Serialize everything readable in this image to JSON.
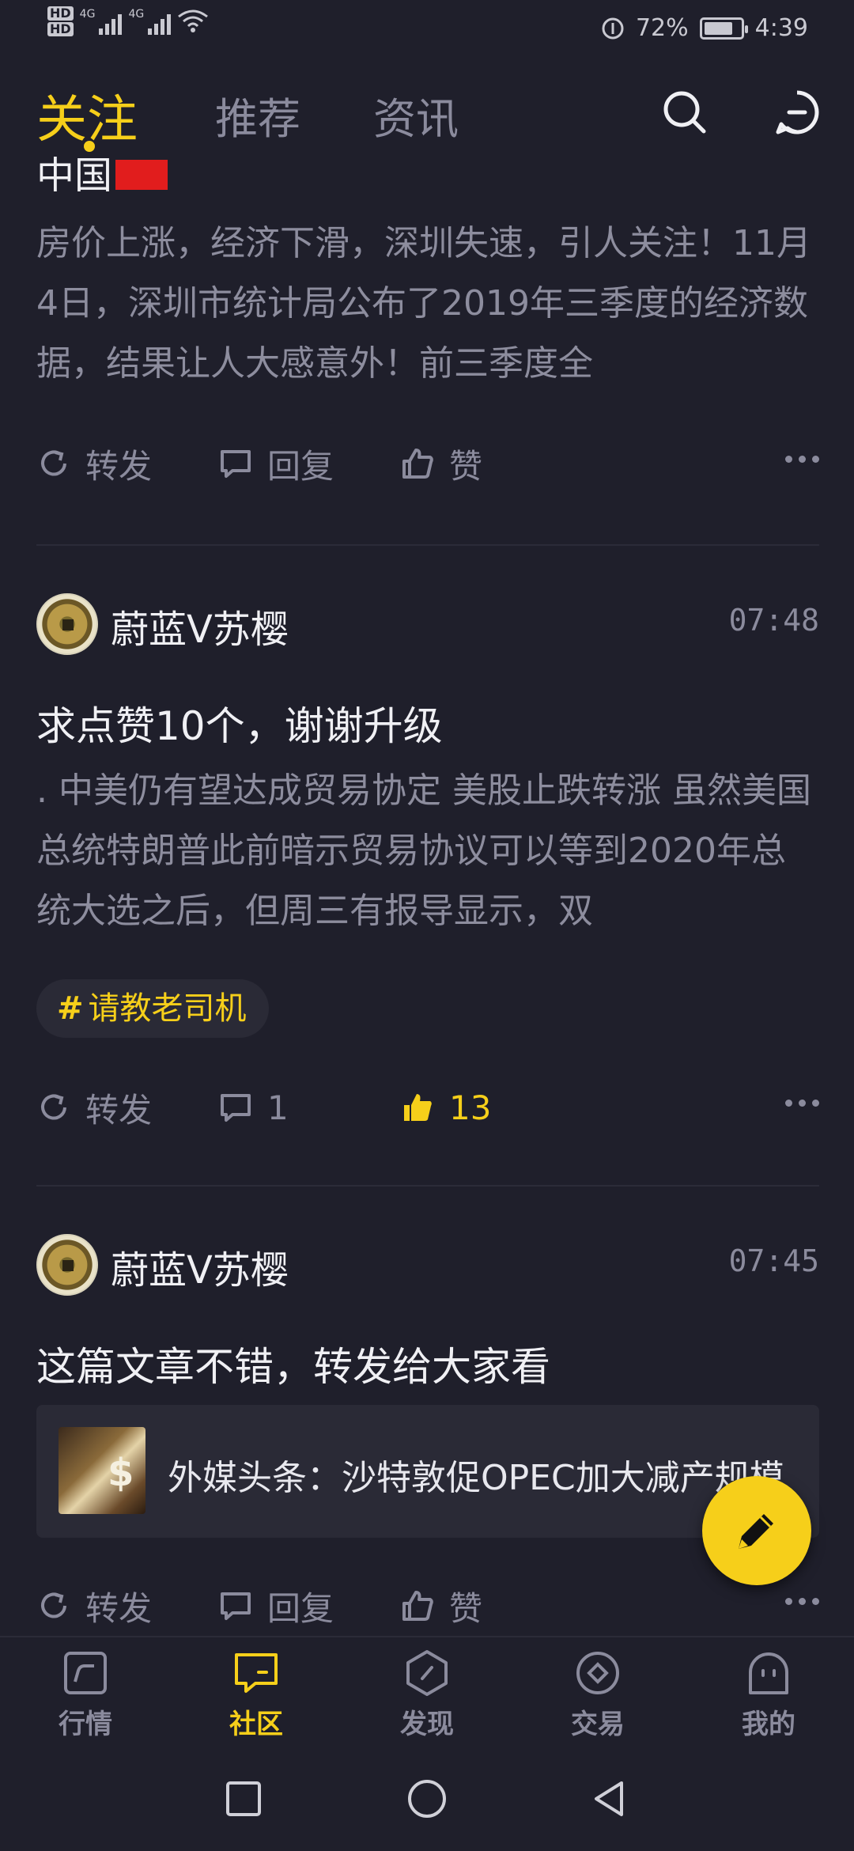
{
  "status_bar": {
    "hd1": "HD",
    "hd2": "HD",
    "net1": "4G",
    "net2": "4G",
    "battery_pct": "72%",
    "time": "4:39"
  },
  "top_tabs": [
    "关注",
    "推荐",
    "资讯"
  ],
  "active_tab": "关注",
  "colors": {
    "accent": "#f6cf1a",
    "background": "#1f1f2b",
    "muted": "#8b8b9d"
  },
  "post0": {
    "title_partial": "中国",
    "body": "房价上涨，经济下滑，深圳失速，引人关注！11月4日，深圳市统计局公布了2019年三季度的经济数据，结果让人大感意外！前三季度全",
    "actions": {
      "repost": "转发",
      "reply": "回复",
      "like": "赞"
    }
  },
  "post1": {
    "author": "蔚蓝V苏樱",
    "time": "07:48",
    "title": "求点赞10个，谢谢升级",
    "body": ". 中美仍有望达成贸易协定 美股止跌转涨 虽然美国总统特朗普此前暗示贸易协议可以等到2020年总统大选之后，但周三有报导显示，双",
    "tag": "请教老司机",
    "actions": {
      "repost": "转发",
      "reply": "1",
      "like": "13"
    }
  },
  "post2": {
    "author": "蔚蓝V苏樱",
    "time": "07:45",
    "title": "这篇文章不错，转发给大家看",
    "shared_title": "外媒头条：沙特敦促OPEC加大减产规模",
    "actions": {
      "repost": "转发",
      "reply": "回复",
      "like": "赞"
    }
  },
  "bottom_nav": [
    {
      "label": "行情",
      "icon": "market-icon"
    },
    {
      "label": "社区",
      "icon": "community-icon"
    },
    {
      "label": "发现",
      "icon": "discover-icon"
    },
    {
      "label": "交易",
      "icon": "trade-icon"
    },
    {
      "label": "我的",
      "icon": "profile-icon"
    }
  ],
  "active_nav": "社区"
}
